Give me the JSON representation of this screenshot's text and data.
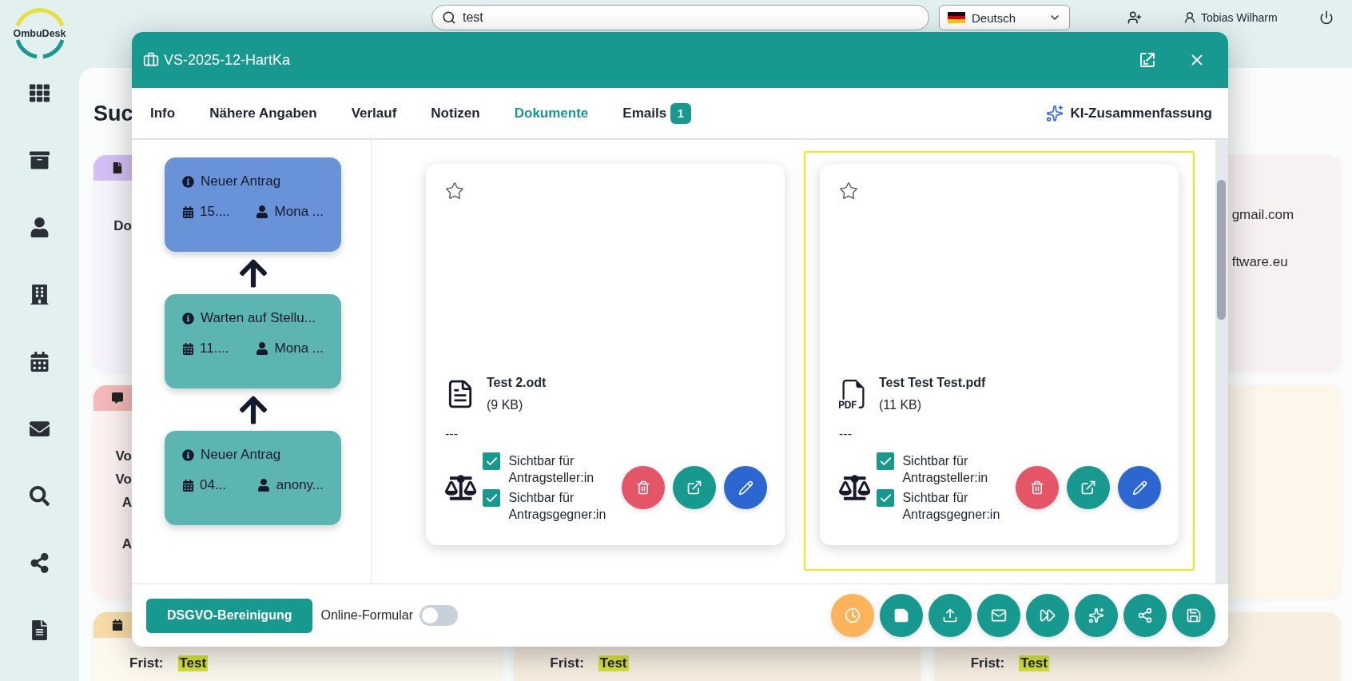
{
  "app": {
    "logo": "OmbuDesk"
  },
  "header": {
    "search": {
      "value": "test"
    },
    "language": "Deutsch",
    "user": "Tobias Wilharm"
  },
  "page": {
    "heading": "Suc",
    "cards": [
      {
        "kind": "document",
        "color": "#d4c0f5",
        "lines": [
          "Do"
        ]
      },
      {
        "color": "#f8f1f1",
        "lines": [
          "gmail.com",
          "ftware.eu"
        ]
      },
      {
        "kind": "message",
        "color": "#f4b9b9",
        "lines": [
          "Vo",
          "Vo",
          "A",
          "A"
        ]
      },
      {
        "color": "#fdf6ea"
      },
      {
        "kind": "deadline",
        "color": "#f7dca8",
        "fields": [
          {
            "label": "Frist:",
            "value": "Test"
          }
        ]
      },
      {
        "color": "#f8efe2",
        "fields": [
          {
            "label": "Frist:",
            "value": "Test"
          }
        ]
      },
      {
        "color": "#f8efe2",
        "fields": [
          {
            "label": "Frist:",
            "value": "Test"
          }
        ]
      }
    ]
  },
  "dialog": {
    "title": "VS-2025-12-HartKa",
    "tabs": [
      {
        "label": "Info",
        "selected": false
      },
      {
        "label": "Nähere Angaben",
        "selected": false
      },
      {
        "label": "Verlauf",
        "selected": false
      },
      {
        "label": "Notizen",
        "selected": false
      },
      {
        "label": "Dokumente",
        "selected": true
      },
      {
        "label": "Emails",
        "badge": "1",
        "selected": false
      }
    ],
    "ai_button": "KI-Zusammenfassung",
    "workflow": [
      {
        "status": "Neuer Antrag",
        "date": "15....",
        "person": "Mona ...",
        "color": "#6893d9"
      },
      {
        "status": "Warten auf Stellu...",
        "date": "11....",
        "person": "Mona ...",
        "color": "#5cb5b0"
      },
      {
        "status": "Neuer Antrag",
        "date": "04...",
        "person": "anony...",
        "color": "#5cb5b0"
      }
    ],
    "documents": [
      {
        "kind": "text",
        "name": "Test 2.odt",
        "size": "(9 KB)",
        "note": "---",
        "starred": false,
        "selected": false,
        "visibility": [
          {
            "label": "Sichtbar für Antragsteller:in",
            "checked": true
          },
          {
            "label": "Sichtbar für Antragsgegner:in",
            "checked": true
          }
        ]
      },
      {
        "kind": "pdf",
        "name": "Test Test Test.pdf",
        "size": "(11 KB)",
        "note": "---",
        "starred": false,
        "selected": true,
        "visibility": [
          {
            "label": "Sichtbar für Antragsteller:in",
            "checked": true
          },
          {
            "label": "Sichtbar für Antragsgegner:in",
            "checked": true
          }
        ]
      }
    ],
    "footer": {
      "cleanup_button": "DSGVO-Bereinigung",
      "online_form": {
        "label": "Online-Formular",
        "on": false
      },
      "actions": [
        {
          "kind": "clock",
          "color": "#fbb459"
        },
        {
          "kind": "note",
          "color": "#189990"
        },
        {
          "kind": "upload",
          "color": "#189990"
        },
        {
          "kind": "mail",
          "color": "#189990"
        },
        {
          "kind": "forward",
          "color": "#189990"
        },
        {
          "kind": "sparkles",
          "color": "#189990"
        },
        {
          "kind": "share",
          "color": "#189990"
        },
        {
          "kind": "save",
          "color": "#189990"
        }
      ]
    }
  }
}
